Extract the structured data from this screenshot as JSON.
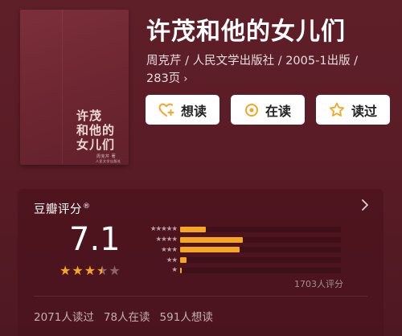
{
  "book": {
    "cover": {
      "title_lines": [
        "许茂",
        "和他的",
        "女儿们"
      ],
      "author": "周克芹 著",
      "publisher": "人民文学出版社"
    },
    "title": "许茂和他的女儿们",
    "meta_line": "周克芹 / 人民文学出版社 / 2005-1出版 /",
    "pages": "283页",
    "chevron": "›"
  },
  "actions": {
    "want": {
      "label": "想读",
      "icon": "heart-plus-icon"
    },
    "reading": {
      "label": "在读",
      "icon": "target-circle-icon"
    },
    "read": {
      "label": "读过",
      "icon": "star-outline-icon"
    }
  },
  "rating": {
    "header": "豆瓣评分",
    "header_mark": "®",
    "score": "7.1",
    "stars_value": 3.5,
    "stars_max": 5,
    "distribution": [
      {
        "stars": 5,
        "label": "★★★★★",
        "fraction": 0.16
      },
      {
        "stars": 4,
        "label": "★★★★",
        "fraction": 0.39
      },
      {
        "stars": 3,
        "label": "★★★",
        "fraction": 0.37
      },
      {
        "stars": 2,
        "label": "★★",
        "fraction": 0.04
      },
      {
        "stars": 1,
        "label": "★",
        "fraction": 0.01
      }
    ],
    "votes": "1703人评分",
    "stats": [
      "2071人读过",
      "78人在读",
      "591人想读"
    ]
  },
  "colors": {
    "background": "#5a1c26",
    "accent_star": "#f5a623",
    "button_bg": "#ffffff"
  }
}
